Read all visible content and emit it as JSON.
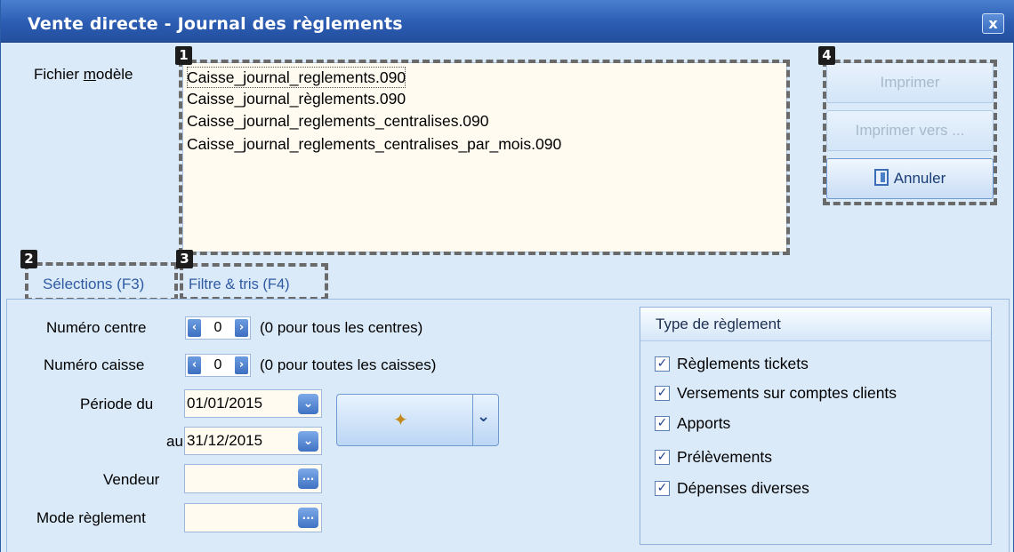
{
  "window": {
    "title": "Vente directe - Journal des règlements",
    "close_glyph": "x"
  },
  "model": {
    "label_prefix": "Fichier ",
    "label_mnemonic": "m",
    "label_suffix": "odèle",
    "files": [
      "Caisse_journal_reglements.090",
      "Caisse_journal_règlements.090",
      "Caisse_journal_reglements_centralises.090",
      "Caisse_journal_reglements_centralises_par_mois.090"
    ]
  },
  "markers": [
    "1",
    "2",
    "3",
    "4"
  ],
  "actions": {
    "print_label": "Imprimer",
    "print_to_label": "Imprimer vers ...",
    "cancel_label": "Annuler"
  },
  "tabs": {
    "selections": "Sélections (F3)",
    "filters": "Filtre & tris (F4)"
  },
  "form": {
    "centre_label": "Numéro centre",
    "centre_value": "0",
    "centre_hint": "(0 pour tous les centres)",
    "caisse_label": "Numéro caisse",
    "caisse_value": "0",
    "caisse_hint": "(0 pour toutes les caisses)",
    "period_from_label": "Période du",
    "period_from_value": "01/01/2015",
    "period_to_label": "au",
    "period_to_value": "31/12/2015",
    "vendor_label": "Vendeur",
    "vendor_value": "",
    "payment_mode_label": "Mode règlement",
    "payment_mode_value": ""
  },
  "payment_types": {
    "title": "Type de règlement",
    "items": [
      {
        "label": "Règlements tickets",
        "checked": true
      },
      {
        "label": "Versements sur comptes clients",
        "checked": true
      },
      {
        "label": "Apports",
        "checked": true
      },
      {
        "label": "Prélèvements",
        "checked": true
      },
      {
        "label": "Dépenses diverses",
        "checked": true
      }
    ]
  },
  "icons": {
    "close": "close-icon",
    "spin_left": "chevron-left-icon",
    "spin_right": "chevron-right-icon",
    "dropdown": "chevron-down-icon",
    "ellipsis": "ellipsis-icon",
    "wand": "magic-wand-icon",
    "exit_door": "exit-door-icon",
    "check": "check-icon"
  },
  "colors": {
    "titlebar": "#2b5cb2",
    "window_bg": "#dbeaf9",
    "list_bg": "#fffbf1",
    "tab_text": "#2f5ba3"
  }
}
